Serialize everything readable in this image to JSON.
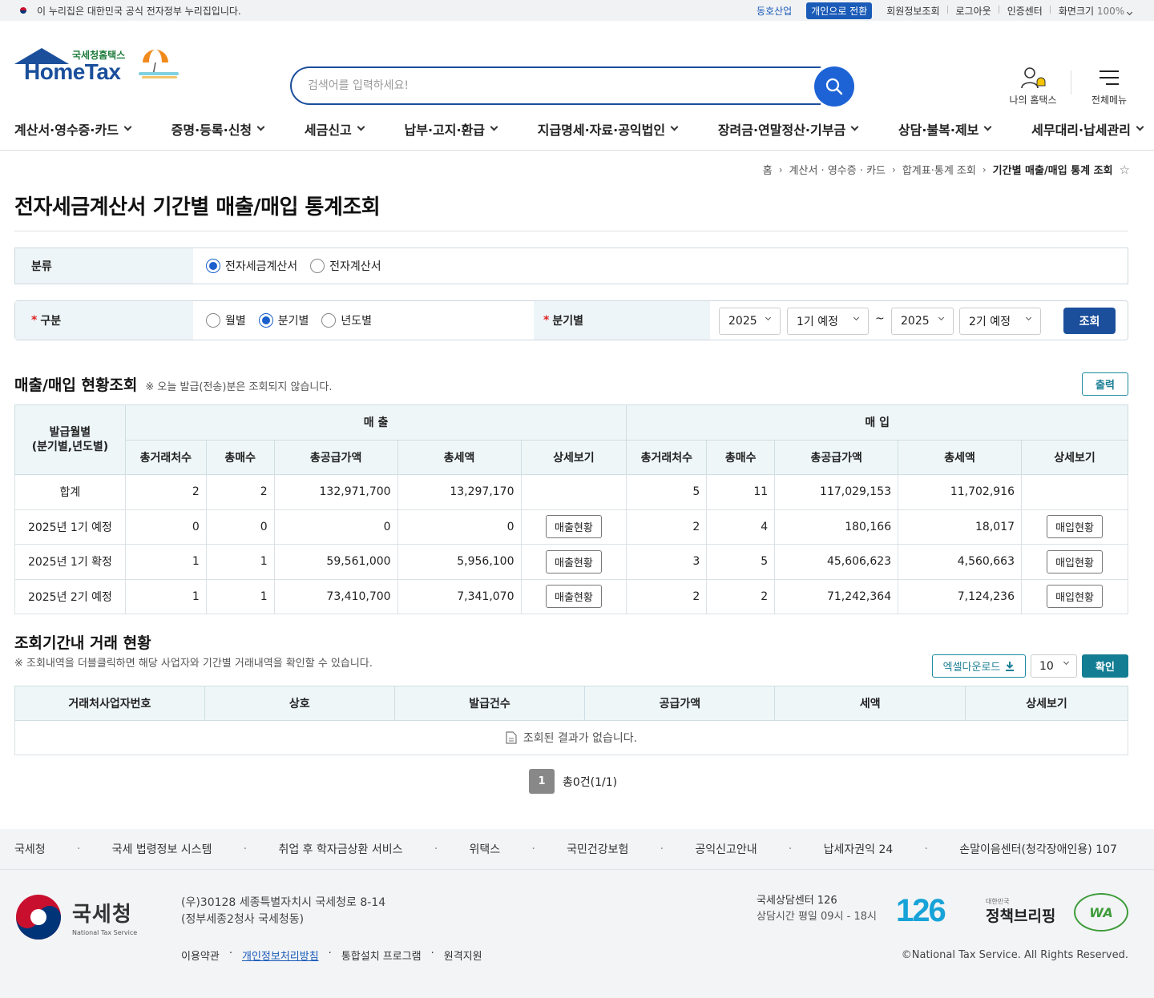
{
  "topbar": {
    "notice": "이 누리집은 대한민국 공식 전자정부 누리집입니다.",
    "company": "동호산업",
    "switch_btn": "개인으로 전환",
    "member_info": "회원정보조회",
    "logout": "로그아웃",
    "cert_center": "인증센터",
    "zoom_label": "화면크기",
    "zoom_value": "100%"
  },
  "header": {
    "logo_sub": "국세청홈택스",
    "logo_main": "HomeTax",
    "search_placeholder": "검색어를 입력하세요!",
    "my_hometax": "나의 홈택스",
    "all_menu": "전체메뉴"
  },
  "gnb": [
    "계산서·영수증·카드",
    "증명·등록·신청",
    "세금신고",
    "납부·고지·환급",
    "지급명세·자료·공익법인",
    "장려금·연말정산·기부금",
    "상담·불복·제보",
    "세무대리·납세관리"
  ],
  "breadcrumb": [
    "홈",
    "계산서 · 영수증 · 카드",
    "합계표·통계 조회",
    "기간별 매출/매입 통계 조회"
  ],
  "page_title": "전자세금계산서 기간별 매출/매입 통계조회",
  "filter": {
    "category_label": "분류",
    "category_options": [
      "전자세금계산서",
      "전자계산서"
    ],
    "category_selected": 0,
    "period_label": "구분",
    "period_options": [
      "월별",
      "분기별",
      "년도별"
    ],
    "period_selected": 1,
    "quarter_label": "분기별",
    "from_year": "2025",
    "from_quarter": "1기 예정",
    "tilde": "~",
    "to_year": "2025",
    "to_quarter": "2기 예정",
    "query_btn": "조회"
  },
  "summary": {
    "title": "매출/매입 현황조회",
    "note": "※ 오늘 발급(전송)분은 조회되지 않습니다.",
    "print_btn": "출력",
    "col_period": "발급월별\n(분기별,년도별)",
    "group_sales": "매 출",
    "group_purchase": "매 입",
    "cols": [
      "총거래처수",
      "총매수",
      "총공급가액",
      "총세액",
      "상세보기"
    ],
    "sales_btn": "매출현황",
    "purchase_btn": "매입현황",
    "rows": [
      {
        "period": "합계",
        "s": [
          "2",
          "2",
          "132,971,700",
          "13,297,170"
        ],
        "p": [
          "5",
          "11",
          "117,029,153",
          "11,702,916"
        ],
        "btn": false
      },
      {
        "period": "2025년 1기 예정",
        "s": [
          "0",
          "0",
          "0",
          "0"
        ],
        "p": [
          "2",
          "4",
          "180,166",
          "18,017"
        ],
        "btn": true
      },
      {
        "period": "2025년 1기 확정",
        "s": [
          "1",
          "1",
          "59,561,000",
          "5,956,100"
        ],
        "p": [
          "3",
          "5",
          "45,606,623",
          "4,560,663"
        ],
        "btn": true
      },
      {
        "period": "2025년 2기 예정",
        "s": [
          "1",
          "1",
          "73,410,700",
          "7,341,070"
        ],
        "p": [
          "2",
          "2",
          "71,242,364",
          "7,124,236"
        ],
        "btn": true
      }
    ]
  },
  "detail": {
    "title": "조회기간내 거래 현황",
    "note": "※ 조회내역을 더블클릭하면 해당 사업자와 기간별 거래내역을 확인할 수 있습니다.",
    "excel_btn": "엑셀다운로드",
    "page_size": "10",
    "confirm_btn": "확인",
    "cols": [
      "거래처사업자번호",
      "상호",
      "발급건수",
      "공급가액",
      "세액",
      "상세보기"
    ],
    "empty": "조회된 결과가 없습니다.",
    "page": "1",
    "total": "총0건(1/1)"
  },
  "footer": {
    "links": [
      "국세청",
      "국세 법령정보 시스템",
      "취업 후 학자금상환 서비스",
      "위택스",
      "국민건강보험",
      "공익신고안내",
      "납세자권익 24",
      "손말이음센터(청각장애인용) 107"
    ],
    "org_name": "국세청",
    "org_en": "National Tax Service",
    "addr1": "(우)30128 세종특별자치시 국세청로 8-14",
    "addr2": "(정부세종2청사 국세청동)",
    "policies": [
      "이용약관",
      "개인정보처리방침",
      "통합설치 프로그램",
      "원격지원"
    ],
    "center": "국세상담센터 126",
    "hours": "상담시간 평일 09시 - 18시",
    "badge_126": "126",
    "brief_small": "대한민국",
    "brief": "정책브리핑",
    "wa": "WA",
    "copyright": "©National Tax Service. All Rights Reserved."
  }
}
